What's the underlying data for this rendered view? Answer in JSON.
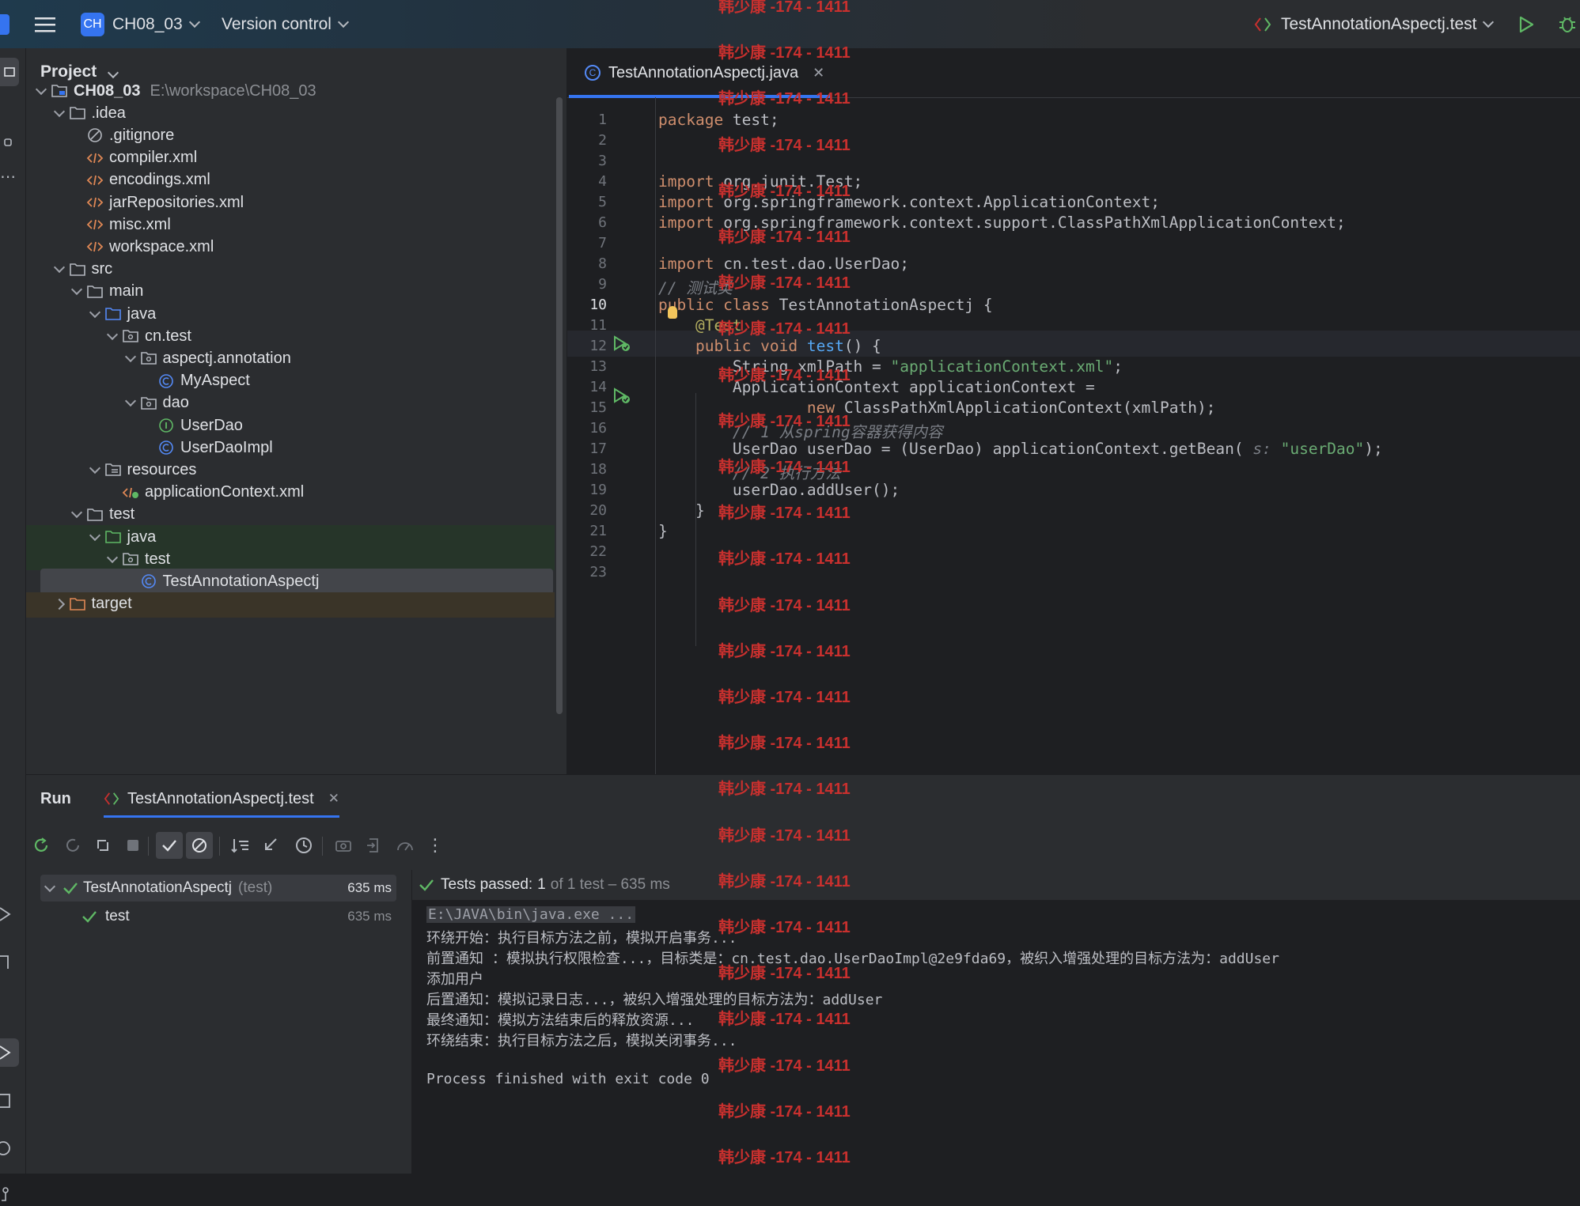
{
  "titlebar": {
    "project_badge": "CH",
    "project_name": "CH08_03",
    "vcs_label": "Version control",
    "run_config": "TestAnnotationAspectj.test"
  },
  "project_panel": {
    "title": "Project",
    "tree": [
      {
        "label": "CH08_03",
        "hint": "E:\\workspace\\CH08_03",
        "depth": 0,
        "kind": "module",
        "expanded": true,
        "bold": true
      },
      {
        "label": ".idea",
        "depth": 1,
        "kind": "folder",
        "expanded": true
      },
      {
        "label": ".gitignore",
        "depth": 2,
        "kind": "ignore"
      },
      {
        "label": "compiler.xml",
        "depth": 2,
        "kind": "xml"
      },
      {
        "label": "encodings.xml",
        "depth": 2,
        "kind": "xml"
      },
      {
        "label": "jarRepositories.xml",
        "depth": 2,
        "kind": "xml"
      },
      {
        "label": "misc.xml",
        "depth": 2,
        "kind": "xml"
      },
      {
        "label": "workspace.xml",
        "depth": 2,
        "kind": "xml"
      },
      {
        "label": "src",
        "depth": 1,
        "kind": "folder",
        "expanded": true
      },
      {
        "label": "main",
        "depth": 2,
        "kind": "folder",
        "expanded": true
      },
      {
        "label": "java",
        "depth": 3,
        "kind": "src-folder",
        "expanded": true
      },
      {
        "label": "cn.test",
        "depth": 4,
        "kind": "package",
        "expanded": true
      },
      {
        "label": "aspectj.annotation",
        "depth": 5,
        "kind": "package",
        "expanded": true
      },
      {
        "label": "MyAspect",
        "depth": 6,
        "kind": "class"
      },
      {
        "label": "dao",
        "depth": 5,
        "kind": "package",
        "expanded": true
      },
      {
        "label": "UserDao",
        "depth": 6,
        "kind": "interface"
      },
      {
        "label": "UserDaoImpl",
        "depth": 6,
        "kind": "class"
      },
      {
        "label": "resources",
        "depth": 3,
        "kind": "res-folder",
        "expanded": true
      },
      {
        "label": "applicationContext.xml",
        "depth": 4,
        "kind": "spring-xml"
      },
      {
        "label": "test",
        "depth": 2,
        "kind": "folder",
        "expanded": true
      },
      {
        "label": "java",
        "depth": 3,
        "kind": "test-folder",
        "expanded": true,
        "test_root": true
      },
      {
        "label": "test",
        "depth": 4,
        "kind": "package",
        "expanded": true,
        "test_root": true
      },
      {
        "label": "TestAnnotationAspectj",
        "depth": 5,
        "kind": "class",
        "selected": true
      },
      {
        "label": "target",
        "depth": 1,
        "kind": "excluded-folder",
        "expanded": false
      }
    ]
  },
  "editor": {
    "tab_label": "TestAnnotationAspectj.java",
    "line_numbers": [
      "1",
      "2",
      "3",
      "4",
      "5",
      "6",
      "7",
      "8",
      "9",
      "10",
      "11",
      "12",
      "13",
      "14",
      "15",
      "16",
      "17",
      "18",
      "19",
      "20",
      "21",
      "22",
      "23"
    ],
    "current_line": "10",
    "code": [
      [
        {
          "t": "package",
          "c": "kw"
        },
        {
          "t": " test;"
        }
      ],
      [],
      [],
      [
        {
          "t": "import",
          "c": "kw"
        },
        {
          "t": " org.junit.Test;"
        }
      ],
      [
        {
          "t": "import",
          "c": "kw"
        },
        {
          "t": " org.springframework.context.ApplicationContext;"
        }
      ],
      [
        {
          "t": "import",
          "c": "kw"
        },
        {
          "t": " org.springframework.context.support.ClassPathXmlApplicationContext;"
        }
      ],
      [],
      [
        {
          "t": "import",
          "c": "kw"
        },
        {
          "t": " cn.test.dao.UserDao;"
        }
      ],
      [
        {
          "t": "// 测试类",
          "c": "cmt"
        }
      ],
      [
        {
          "t": "public class",
          "c": "kw"
        },
        {
          "t": " TestAnnotationAspectj {"
        }
      ],
      [
        {
          "t": "    "
        },
        {
          "t": "@Test",
          "c": "ann"
        }
      ],
      [
        {
          "t": "    "
        },
        {
          "t": "public void",
          "c": "kw"
        },
        {
          "t": " "
        },
        {
          "t": "test",
          "c": "fn"
        },
        {
          "t": "() {"
        }
      ],
      [
        {
          "t": "        String xmlPath = "
        },
        {
          "t": "\"applicationContext.xml\"",
          "c": "str"
        },
        {
          "t": ";"
        }
      ],
      [
        {
          "t": "        ApplicationContext applicationContext ="
        }
      ],
      [
        {
          "t": "                "
        },
        {
          "t": "new",
          "c": "kw"
        },
        {
          "t": " ClassPathXmlApplicationContext(xmlPath);"
        }
      ],
      [
        {
          "t": "        // 1 从spring容器获得内容",
          "c": "cmt"
        }
      ],
      [
        {
          "t": "        UserDao userDao = (UserDao) applicationContext.getBean( "
        },
        {
          "t": "s: ",
          "c": "cmt"
        },
        {
          "t": "\"userDao\"",
          "c": "str"
        },
        {
          "t": ");"
        }
      ],
      [
        {
          "t": "        // 2 执行方法",
          "c": "cmt"
        }
      ],
      [
        {
          "t": "        userDao.addUser();"
        }
      ],
      [
        {
          "t": "    }"
        }
      ],
      [
        {
          "t": "}"
        }
      ],
      [],
      []
    ]
  },
  "run_panel": {
    "tab_run": "Run",
    "tab_config": "TestAnnotationAspectj.test",
    "toolbar_icons": [
      "rerun-icon",
      "rerun-failed-icon",
      "toggle-auto-test-icon",
      "stop-icon",
      "show-passed-icon",
      "show-ignored-icon",
      "sort-icon",
      "collapse-icon",
      "history-icon",
      "export-icon",
      "import-icon",
      "coverage-icon",
      "more-icon"
    ],
    "test_tree": [
      {
        "label": "TestAnnotationAspectj",
        "hint": "(test)",
        "time": "635 ms",
        "depth": 0
      },
      {
        "label": "test",
        "hint": "",
        "time": "635 ms",
        "depth": 1
      }
    ],
    "status_prefix": "Tests passed:",
    "status_count": "1",
    "status_rest": "of 1 test – 635 ms",
    "console": [
      "E:\\JAVA\\bin\\java.exe ...",
      "环绕开始：执行目标方法之前，模拟开启事务...",
      "前置通知 ：模拟执行权限检查...，目标类是：cn.test.dao.UserDaoImpl@2e9fda69，被织入增强处理的目标方法为：addUser",
      "添加用户",
      "后置通知：模拟记录日志...，被织入增强处理的目标方法为：addUser",
      "最终通知：模拟方法结束后的释放资源...",
      "环绕结束：执行目标方法之后，模拟关闭事务...",
      "",
      "Process finished with exit code 0"
    ]
  },
  "watermark": "韩少康 -174 - 1411",
  "colors": {
    "accent": "#3574f0",
    "success": "#5fb865",
    "watermark": "#c8302e",
    "keyword": "#cf8e6d",
    "string": "#6aab73"
  }
}
